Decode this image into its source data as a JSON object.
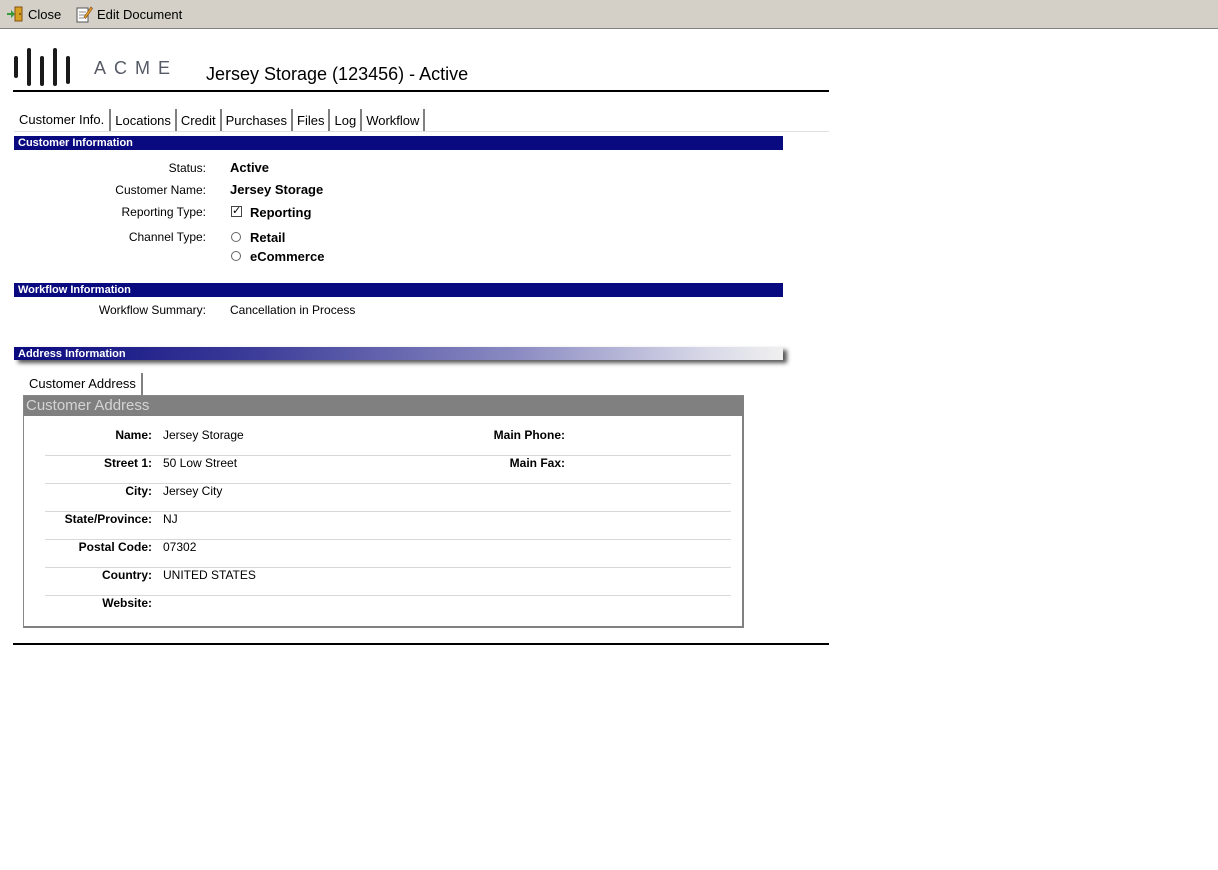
{
  "toolbar": {
    "close_label": "Close",
    "edit_label": "Edit Document"
  },
  "header": {
    "logo_text": "ACME",
    "title": "Jersey Storage (123456) - Active"
  },
  "tabs": [
    {
      "label": "Customer Info.",
      "active": true
    },
    {
      "label": "Locations"
    },
    {
      "label": "Credit"
    },
    {
      "label": "Purchases"
    },
    {
      "label": "Files"
    },
    {
      "label": "Log"
    },
    {
      "label": "Workflow"
    }
  ],
  "customer_info": {
    "section_title": "Customer Information",
    "status_label": "Status:",
    "status_value": "Active",
    "name_label": "Customer Name:",
    "name_value": "Jersey Storage",
    "reporting_label": "Reporting Type:",
    "reporting_option": "Reporting",
    "reporting_checked": true,
    "channel_label": "Channel Type:",
    "channel_options": [
      "Retail",
      "eCommerce"
    ]
  },
  "workflow_info": {
    "section_title": "Workflow Information",
    "summary_label": "Workflow Summary:",
    "summary_value": "Cancellation in Process"
  },
  "address_info": {
    "section_title": "Address Information",
    "tab_label": "Customer Address",
    "panel_title": "Customer Address",
    "rows": [
      {
        "label": "Name:",
        "value": "Jersey Storage",
        "label2": "Main Phone:"
      },
      {
        "label": "Street 1:",
        "value": "50 Low Street",
        "label2": "Main Fax:"
      },
      {
        "label": "City:",
        "value": "Jersey City"
      },
      {
        "label": "State/Province:",
        "value": "NJ"
      },
      {
        "label": "Postal Code:",
        "value": "07302"
      },
      {
        "label": "Country:",
        "value": "UNITED STATES"
      },
      {
        "label": "Website:",
        "value": ""
      }
    ]
  },
  "colors": {
    "toolbar_bg": "#d4d0c8",
    "section_bar": "#0a0a80",
    "panel_header": "#808080"
  }
}
